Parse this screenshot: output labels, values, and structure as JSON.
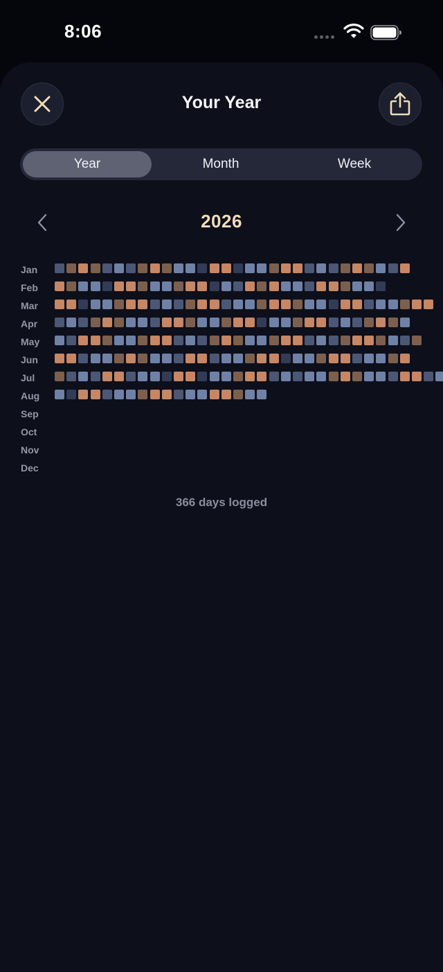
{
  "status_bar": {
    "time": "8:06",
    "icons": [
      "signal-dots",
      "wifi-icon",
      "battery-icon"
    ]
  },
  "header": {
    "title": "Your Year",
    "close_icon": "close-icon",
    "share_icon": "share-icon"
  },
  "segmented_control": {
    "segments": [
      {
        "label": "Year",
        "selected": true
      },
      {
        "label": "Month",
        "selected": false
      },
      {
        "label": "Week",
        "selected": false
      }
    ]
  },
  "year_nav": {
    "year": "2026",
    "prev_icon": "chevron-left-icon",
    "next_icon": "chevron-right-icon"
  },
  "colors": {
    "orange": "#c78664",
    "brown": "#7c604d",
    "blue": "#6f81a6",
    "slate": "#4b5774",
    "navy": "#323c56",
    "accent_year": "#f1ddb8"
  },
  "heatmap": {
    "legend_note": "O=orange, B=brown, L=blue, S=slate, N=navy",
    "months": [
      {
        "label": "Jan",
        "days": "SBOBSLSBOBLLNOONLLBOOSLSBOBLSO"
      },
      {
        "label": "Feb",
        "days": "OBLLNOOBLLBOONLSOBOLLSOOBLLN"
      },
      {
        "label": "Mar",
        "days": "OONLLBOOSLSBOOSLLBOOBLLNOOSLLBOO"
      },
      {
        "label": "Apr",
        "days": "SLSBOBLLSOOBLLBOONLLBOOSLSBOBL"
      },
      {
        "label": "May",
        "days": "LSOOBLLBOOSLSBOBLLBOOSLSBOOBLSB"
      },
      {
        "label": "Jun",
        "days": "OOSLLBOBLLSOOSLLBOONLLBOOSLLBO"
      },
      {
        "label": "Jul",
        "days": "BSLSOOSLLNOONLLBOOSLSLLBOBLLSOOSL"
      },
      {
        "label": "Aug",
        "days": "LNOOSLLBOOSLLOOBLL"
      },
      {
        "label": "Sep",
        "days": ""
      },
      {
        "label": "Oct",
        "days": ""
      },
      {
        "label": "Nov",
        "days": ""
      },
      {
        "label": "Dec",
        "days": ""
      }
    ]
  },
  "footer": {
    "days_logged": "366 days logged"
  }
}
